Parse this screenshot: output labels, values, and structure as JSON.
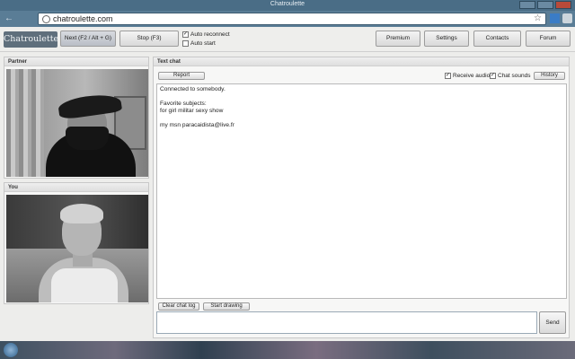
{
  "browser": {
    "tab_title": "Chatroulette",
    "url": "chatroulette.com"
  },
  "header": {
    "logo": "Chatroulette",
    "next_label": "Next (F2 / Alt + G)",
    "stop_label": "Stop (F3)",
    "auto_reconnect": {
      "label": "Auto reconnect",
      "checked": true
    },
    "auto_start": {
      "label": "Auto start",
      "checked": false
    },
    "nav": [
      "Premium",
      "Settings",
      "Contacts",
      "Forum"
    ]
  },
  "partner": {
    "title": "Partner"
  },
  "you": {
    "title": "You"
  },
  "chat": {
    "title": "Text chat",
    "report_label": "Report",
    "receive_audio": {
      "label": "Receive audio",
      "checked": true
    },
    "chat_sounds": {
      "label": "Chat sounds",
      "checked": true
    },
    "history_label": "History",
    "messages": [
      "Connected to somebody.",
      "",
      "Favorite subjects:",
      "for girl militar sexy show",
      "",
      "my msn paracaidista@live.fr"
    ],
    "clear_label": "Clear chat log",
    "drawing_label": "Start drawing",
    "send_label": "Send"
  },
  "colors": {
    "titlebar": "#4a6d86",
    "logo_bg": "#5f6f7c",
    "panel_bg": "#f7f7f6"
  }
}
